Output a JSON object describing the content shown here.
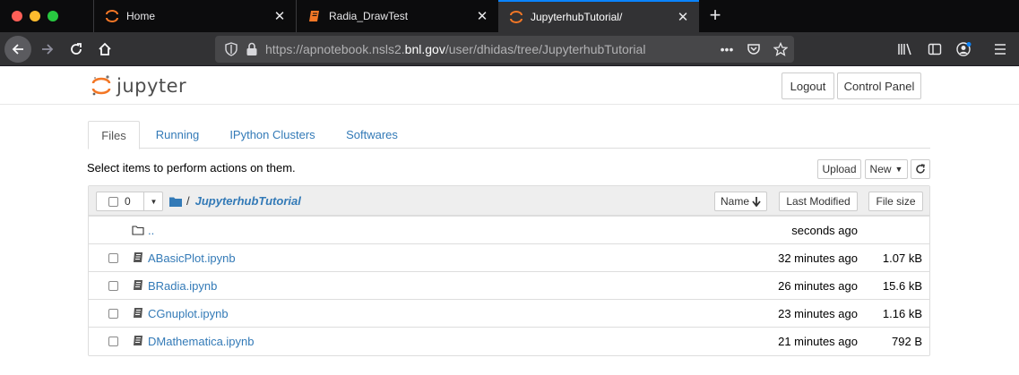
{
  "browser": {
    "tabs": [
      {
        "title": "Home",
        "icon": "jupyter-favicon-icon"
      },
      {
        "title": "Radia_DrawTest",
        "icon": "notebook-favicon-icon"
      },
      {
        "title": "JupyterhubTutorial/",
        "icon": "jupyter-favicon-icon",
        "active": true
      }
    ],
    "url": {
      "prefix": "https://apnotebook.nsls2.",
      "host": "bnl.gov",
      "path": "/user/dhidas/tree/JupyterhubTutorial"
    },
    "colors": {
      "accent": "#0a84ff",
      "tab_bar": "#0c0c0d",
      "toolbar": "#323234"
    }
  },
  "header": {
    "logo_text": "jupyter",
    "logout_label": "Logout",
    "control_panel_label": "Control Panel"
  },
  "tabs": [
    {
      "label": "Files",
      "active": true
    },
    {
      "label": "Running"
    },
    {
      "label": "IPython Clusters"
    },
    {
      "label": "Softwares"
    }
  ],
  "toolbar": {
    "hint": "Select items to perform actions on them.",
    "upload_label": "Upload",
    "new_label": "New"
  },
  "list": {
    "selected_count": "0",
    "breadcrumb_sep": "/",
    "current_dir": "JupyterhubTutorial",
    "sort_name_label": "Name",
    "last_modified_label": "Last Modified",
    "file_size_label": "File size",
    "parent": {
      "name": "..",
      "modified": "seconds ago"
    },
    "items": [
      {
        "name": "ABasicPlot.ipynb",
        "modified": "32 minutes ago",
        "size": "1.07 kB"
      },
      {
        "name": "BRadia.ipynb",
        "modified": "26 minutes ago",
        "size": "15.6 kB"
      },
      {
        "name": "CGnuplot.ipynb",
        "modified": "23 minutes ago",
        "size": "1.16 kB"
      },
      {
        "name": "DMathematica.ipynb",
        "modified": "21 minutes ago",
        "size": "792 B"
      }
    ]
  }
}
